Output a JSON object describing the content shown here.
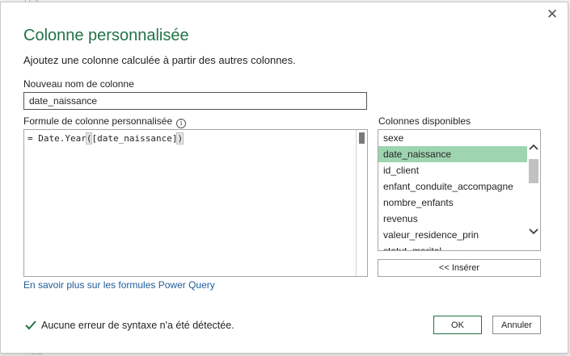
{
  "dialog": {
    "title": "Colonne personnalisée",
    "subtitle": "Ajoutez une colonne calculée à partir des autres colonnes.",
    "close_glyph": "✕",
    "name_label": "Nouveau nom de colonne",
    "name_value": "date_naissance",
    "formula_label": "Formule de colonne personnalisée",
    "info_glyph": "i",
    "formula": {
      "prefix": "= Date.Year",
      "bracket_open": "(",
      "argument": "[date_naissance]",
      "bracket_close": ")"
    },
    "columns_label": "Colonnes disponibles",
    "columns": [
      "sexe",
      "date_naissance",
      "id_client",
      "enfant_conduite_accompagne",
      "nombre_enfants",
      "revenus",
      "valeur_residence_prin",
      "statut_marital"
    ],
    "selected_column": "date_naissance",
    "insert_label": "<< Insérer",
    "learn_link": "En savoir plus sur les formules Power Query",
    "status_text": "Aucune erreur de syntaxe n'a été détectée.",
    "ok_label": "OK",
    "cancel_label": "Annuler"
  },
  "icons": {
    "close": "close-icon",
    "info": "info-icon",
    "check": "checkmark-icon",
    "scroll_up": "chevron-up-icon",
    "scroll_down": "chevron-down-icon"
  },
  "colors": {
    "accent": "#217346",
    "selection": "#9fd4b1",
    "link": "#1f5c99"
  }
}
